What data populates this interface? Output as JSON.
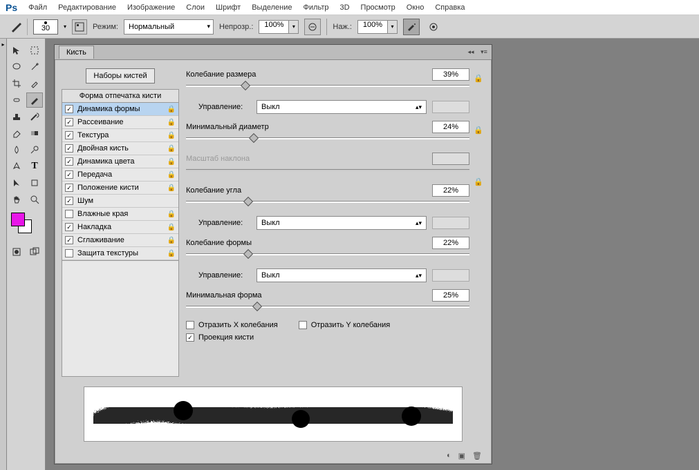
{
  "menu": [
    "Файл",
    "Редактирование",
    "Изображение",
    "Слои",
    "Шрифт",
    "Выделение",
    "Фильтр",
    "3D",
    "Просмотр",
    "Окно",
    "Справка"
  ],
  "logo": "Ps",
  "optionsBar": {
    "brushSize": "30",
    "modeLabel": "Режим:",
    "modeValue": "Нормальный",
    "opacityLabel": "Непрозр.:",
    "opacityValue": "100%",
    "flowLabel": "Наж.:",
    "flowValue": "100%"
  },
  "panel": {
    "title": "Кисть",
    "presetsBtn": "Наборы кистей",
    "sectionHead": "Форма отпечатка кисти",
    "items": [
      {
        "label": "Динамика формы",
        "checked": true,
        "selected": true,
        "locked": true
      },
      {
        "label": "Рассеивание",
        "checked": true,
        "selected": false,
        "locked": true
      },
      {
        "label": "Текстура",
        "checked": true,
        "selected": false,
        "locked": true
      },
      {
        "label": "Двойная кисть",
        "checked": true,
        "selected": false,
        "locked": true
      },
      {
        "label": "Динамика цвета",
        "checked": true,
        "selected": false,
        "locked": true
      },
      {
        "label": "Передача",
        "checked": true,
        "selected": false,
        "locked": true
      },
      {
        "label": "Положение кисти",
        "checked": true,
        "selected": false,
        "locked": true
      },
      {
        "label": "Шум",
        "checked": true,
        "selected": false,
        "locked": false
      },
      {
        "label": "Влажные края",
        "checked": false,
        "selected": false,
        "locked": true
      },
      {
        "label": "Накладка",
        "checked": true,
        "selected": false,
        "locked": true
      },
      {
        "label": "Сглаживание",
        "checked": true,
        "selected": false,
        "locked": true
      },
      {
        "label": "Защита текстуры",
        "checked": false,
        "selected": false,
        "locked": true
      }
    ],
    "params": {
      "sizeJitter": {
        "label": "Колебание размера",
        "value": "39%",
        "pos": 21
      },
      "ctrl1": {
        "label": "Управление:",
        "value": "Выкл"
      },
      "minDiam": {
        "label": "Минимальный диаметр",
        "value": "24%",
        "pos": 24
      },
      "tiltScale": {
        "label": "Масштаб наклона"
      },
      "angleJitter": {
        "label": "Колебание угла",
        "value": "22%",
        "pos": 22
      },
      "ctrl2": {
        "label": "Управление:",
        "value": "Выкл"
      },
      "roundJitter": {
        "label": "Колебание формы",
        "value": "22%",
        "pos": 22
      },
      "ctrl3": {
        "label": "Управление:",
        "value": "Выкл"
      },
      "minRound": {
        "label": "Минимальная форма",
        "value": "25%",
        "pos": 25
      },
      "flipX": {
        "label": "Отразить X колебания",
        "checked": false
      },
      "flipY": {
        "label": "Отразить Y колебания",
        "checked": false
      },
      "proj": {
        "label": "Проекция кисти",
        "checked": true
      }
    }
  },
  "colors": {
    "fg": "#e815e8",
    "bg": "#ffffff"
  }
}
